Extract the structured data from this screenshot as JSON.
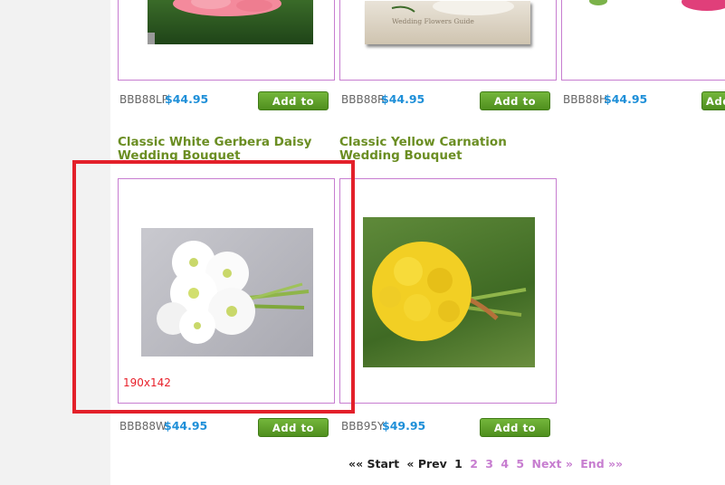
{
  "products": [
    {
      "sku": "BBB88LP",
      "price": "$44.95",
      "cart": "Add to Cart"
    },
    {
      "sku": "BBB88R",
      "price": "$44.95",
      "cart": "Add to Cart",
      "image_caption": "Wedding Flowers Guide"
    },
    {
      "sku": "BBB88H",
      "price": "$44.95",
      "cart": "Add"
    },
    {
      "title": "Classic White Gerbera Daisy Wedding Bouquet",
      "sku": "BBB88W",
      "price": "$44.95",
      "cart": "Add to Cart",
      "dimensions": "190x142"
    },
    {
      "title": "Classic Yellow Carnation Wedding Bouquet",
      "sku": "BBB95Y",
      "price": "$49.95",
      "cart": "Add to Cart"
    }
  ],
  "pager": {
    "start": "«« Start",
    "prev": "« Prev",
    "current": "1",
    "pages": [
      "2",
      "3",
      "4",
      "5"
    ],
    "next": "Next »",
    "end": "End »»"
  },
  "colors": {
    "title": "#6b8e23",
    "price": "#1e8fd8",
    "card_border": "#c77dd0",
    "highlight": "#e3202a",
    "cart_button": "#5a9e26"
  }
}
